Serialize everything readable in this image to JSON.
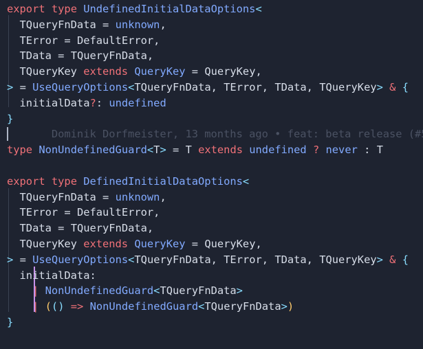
{
  "editor": {
    "lines": [
      {
        "tokens": [
          [
            "kw",
            "export"
          ],
          [
            "plain",
            " "
          ],
          [
            "kw",
            "type"
          ],
          [
            "plain",
            " "
          ],
          [
            "type",
            "UndefinedInitialDataOptions"
          ],
          [
            "angle",
            "<"
          ]
        ]
      },
      {
        "tokens": [
          [
            "plain",
            "  TQueryFnData "
          ],
          [
            "punct",
            "="
          ],
          [
            "plain",
            " "
          ],
          [
            "type",
            "unknown"
          ],
          [
            "punct",
            ","
          ]
        ]
      },
      {
        "tokens": [
          [
            "plain",
            "  TError "
          ],
          [
            "punct",
            "="
          ],
          [
            "plain",
            " DefaultError"
          ],
          [
            "punct",
            ","
          ]
        ]
      },
      {
        "tokens": [
          [
            "plain",
            "  TData "
          ],
          [
            "punct",
            "="
          ],
          [
            "plain",
            " TQueryFnData"
          ],
          [
            "punct",
            ","
          ]
        ]
      },
      {
        "tokens": [
          [
            "plain",
            "  TQueryKey "
          ],
          [
            "kw",
            "extends"
          ],
          [
            "plain",
            " "
          ],
          [
            "type",
            "QueryKey"
          ],
          [
            "plain",
            " "
          ],
          [
            "punct",
            "="
          ],
          [
            "plain",
            " QueryKey"
          ],
          [
            "punct",
            ","
          ]
        ]
      },
      {
        "tokens": [
          [
            "angle",
            ">"
          ],
          [
            "plain",
            " "
          ],
          [
            "punct",
            "="
          ],
          [
            "plain",
            " "
          ],
          [
            "type",
            "UseQueryOptions"
          ],
          [
            "angle",
            "<"
          ],
          [
            "plain",
            "TQueryFnData"
          ],
          [
            "punct",
            ","
          ],
          [
            "plain",
            " TError"
          ],
          [
            "punct",
            ","
          ],
          [
            "plain",
            " TData"
          ],
          [
            "punct",
            ","
          ],
          [
            "plain",
            " TQueryKey"
          ],
          [
            "angle",
            ">"
          ],
          [
            "plain",
            " "
          ],
          [
            "op",
            "&"
          ],
          [
            "plain",
            " "
          ],
          [
            "brace",
            "{"
          ]
        ]
      },
      {
        "tokens": [
          [
            "plain",
            "  initialData"
          ],
          [
            "op",
            "?"
          ],
          [
            "punct",
            ":"
          ],
          [
            "plain",
            " "
          ],
          [
            "und",
            "undefined"
          ]
        ]
      },
      {
        "tokens": [
          [
            "brace",
            "}"
          ]
        ]
      },
      {
        "tokens": [
          [
            "blame",
            "       Dominik Dorfmeister, 13 months ago • feat: beta release (#5"
          ]
        ]
      },
      {
        "tokens": [
          [
            "kw",
            "type"
          ],
          [
            "plain",
            " "
          ],
          [
            "type",
            "NonUndefinedGuard"
          ],
          [
            "angle",
            "<"
          ],
          [
            "plain",
            "T"
          ],
          [
            "angle",
            ">"
          ],
          [
            "plain",
            " "
          ],
          [
            "punct",
            "="
          ],
          [
            "plain",
            " T "
          ],
          [
            "kw",
            "extends"
          ],
          [
            "plain",
            " "
          ],
          [
            "und",
            "undefined"
          ],
          [
            "plain",
            " "
          ],
          [
            "op",
            "?"
          ],
          [
            "plain",
            " "
          ],
          [
            "und",
            "never"
          ],
          [
            "plain",
            " "
          ],
          [
            "punct",
            ":"
          ],
          [
            "plain",
            " T"
          ]
        ]
      },
      {
        "tokens": []
      },
      {
        "tokens": [
          [
            "kw",
            "export"
          ],
          [
            "plain",
            " "
          ],
          [
            "kw",
            "type"
          ],
          [
            "plain",
            " "
          ],
          [
            "type",
            "DefinedInitialDataOptions"
          ],
          [
            "angle",
            "<"
          ]
        ]
      },
      {
        "tokens": [
          [
            "plain",
            "  TQueryFnData "
          ],
          [
            "punct",
            "="
          ],
          [
            "plain",
            " "
          ],
          [
            "type",
            "unknown"
          ],
          [
            "punct",
            ","
          ]
        ]
      },
      {
        "tokens": [
          [
            "plain",
            "  TError "
          ],
          [
            "punct",
            "="
          ],
          [
            "plain",
            " DefaultError"
          ],
          [
            "punct",
            ","
          ]
        ]
      },
      {
        "tokens": [
          [
            "plain",
            "  TData "
          ],
          [
            "punct",
            "="
          ],
          [
            "plain",
            " TQueryFnData"
          ],
          [
            "punct",
            ","
          ]
        ]
      },
      {
        "tokens": [
          [
            "plain",
            "  TQueryKey "
          ],
          [
            "kw",
            "extends"
          ],
          [
            "plain",
            " "
          ],
          [
            "type",
            "QueryKey"
          ],
          [
            "plain",
            " "
          ],
          [
            "punct",
            "="
          ],
          [
            "plain",
            " QueryKey"
          ],
          [
            "punct",
            ","
          ]
        ]
      },
      {
        "tokens": [
          [
            "angle",
            ">"
          ],
          [
            "plain",
            " "
          ],
          [
            "punct",
            "="
          ],
          [
            "plain",
            " "
          ],
          [
            "type",
            "UseQueryOptions"
          ],
          [
            "angle",
            "<"
          ],
          [
            "plain",
            "TQueryFnData"
          ],
          [
            "punct",
            ","
          ],
          [
            "plain",
            " TError"
          ],
          [
            "punct",
            ","
          ],
          [
            "plain",
            " TData"
          ],
          [
            "punct",
            ","
          ],
          [
            "plain",
            " TQueryKey"
          ],
          [
            "angle",
            ">"
          ],
          [
            "plain",
            " "
          ],
          [
            "op",
            "&"
          ],
          [
            "plain",
            " "
          ],
          [
            "brace",
            "{"
          ]
        ]
      },
      {
        "tokens": [
          [
            "plain",
            "  initialData"
          ],
          [
            "punct",
            ":"
          ]
        ]
      },
      {
        "tokens": [
          [
            "plain",
            "    "
          ],
          [
            "pipe",
            "|"
          ],
          [
            "plain",
            " "
          ],
          [
            "type",
            "NonUndefinedGuard"
          ],
          [
            "angle",
            "<"
          ],
          [
            "plain",
            "TQueryFnData"
          ],
          [
            "angle",
            ">"
          ]
        ]
      },
      {
        "tokens": [
          [
            "plain",
            "    "
          ],
          [
            "pipe",
            "|"
          ],
          [
            "plain",
            " "
          ],
          [
            "paren",
            "("
          ],
          [
            "brace",
            "()"
          ],
          [
            "plain",
            " "
          ],
          [
            "kw",
            "=>"
          ],
          [
            "plain",
            " "
          ],
          [
            "type",
            "NonUndefinedGuard"
          ],
          [
            "angle",
            "<"
          ],
          [
            "plain",
            "TQueryFnData"
          ],
          [
            "angle",
            ">"
          ],
          [
            "paren",
            ")"
          ]
        ]
      },
      {
        "tokens": [
          [
            "brace",
            "}"
          ]
        ]
      },
      {
        "tokens": []
      },
      {
        "tokens": [
          [
            "blame",
            "     ___ ___ __ ___ __ _____ ___ ____ _"
          ]
        ]
      }
    ]
  }
}
